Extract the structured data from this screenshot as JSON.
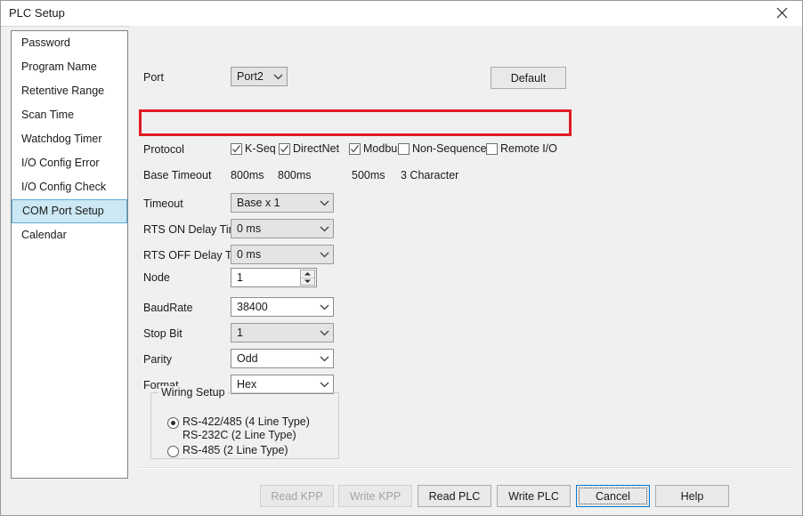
{
  "window": {
    "title": "PLC Setup",
    "close_icon": "close-icon"
  },
  "sidebar": {
    "items": [
      {
        "label": "Password",
        "selected": false
      },
      {
        "label": "Program Name",
        "selected": false
      },
      {
        "label": "Retentive Range",
        "selected": false
      },
      {
        "label": "Scan Time",
        "selected": false
      },
      {
        "label": "Watchdog Timer",
        "selected": false
      },
      {
        "label": "I/O Config Error",
        "selected": false
      },
      {
        "label": "I/O Config Check",
        "selected": false
      },
      {
        "label": "COM Port Setup",
        "selected": true
      },
      {
        "label": "Calendar",
        "selected": false
      }
    ]
  },
  "main": {
    "port": {
      "label": "Port",
      "value": "Port2"
    },
    "default_button": "Default",
    "protocol": {
      "label": "Protocol",
      "highlight_color": "#e01b24",
      "options": [
        {
          "label": "K-Seq",
          "checked": true
        },
        {
          "label": "DirectNet",
          "checked": true
        },
        {
          "label": "Modbus",
          "checked": true
        },
        {
          "label": "Non-Sequence",
          "checked": false
        },
        {
          "label": "Remote I/O",
          "checked": false
        }
      ]
    },
    "base_timeout": {
      "label": "Base Timeout",
      "values": [
        "800ms",
        "800ms",
        "500ms",
        "3 Character"
      ]
    },
    "fields": [
      {
        "label": "Timeout",
        "value": "Base x 1",
        "disabled": true
      },
      {
        "label": "RTS ON Delay Time",
        "value": "0 ms",
        "disabled": true
      },
      {
        "label": "RTS OFF Delay Time",
        "value": "0 ms",
        "disabled": true
      },
      {
        "label": "BaudRate",
        "value": "38400",
        "disabled": false
      },
      {
        "label": "Stop Bit",
        "value": "1",
        "disabled": true
      },
      {
        "label": "Parity",
        "value": "Odd",
        "disabled": false
      },
      {
        "label": "Format",
        "value": "Hex",
        "disabled": false
      }
    ],
    "node": {
      "label": "Node",
      "value": "1"
    },
    "wiring": {
      "title": "Wiring Setup",
      "options": [
        {
          "line1": "RS-422/485 (4 Line Type)",
          "line2": "RS-232C (2 Line Type)",
          "selected": true
        },
        {
          "line1": "RS-485 (2 Line Type)",
          "line2": "",
          "selected": false
        }
      ]
    }
  },
  "buttons": [
    {
      "label": "Read KPP",
      "disabled": true,
      "focused": false
    },
    {
      "label": "Write KPP",
      "disabled": true,
      "focused": false
    },
    {
      "label": "Read PLC",
      "disabled": false,
      "focused": false
    },
    {
      "label": "Write PLC",
      "disabled": false,
      "focused": false
    },
    {
      "label": "Cancel",
      "disabled": false,
      "focused": true
    },
    {
      "label": "Help",
      "disabled": false,
      "focused": false
    }
  ]
}
